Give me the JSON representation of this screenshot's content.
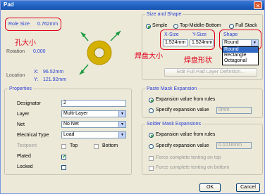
{
  "window": {
    "title": "Pad",
    "close": "✕"
  },
  "preview": {
    "role_size_label": "Role Size",
    "role_size_value": "0.762mm",
    "hole_size_note": "孔大小",
    "rotation_label": "Rotation",
    "rotation_value": "0.000",
    "location_label": "Location",
    "x_label": "X:",
    "x_value": "96.52mm",
    "y_label": "Y:",
    "y_value": "121.92mm",
    "pad_size_note": "焊盘大小",
    "pad_shape_note": "焊盘形状"
  },
  "size_shape": {
    "title": "Size and Shape",
    "modes": [
      "Simple",
      "Top-Middle-Bottom",
      "Full Stack"
    ],
    "selected_mode": "Simple",
    "xsize_header": "X-Size",
    "ysize_header": "Y-Size",
    "shape_header": "Shape",
    "xsize_value": "1.524mm",
    "ysize_value": "1.524mm",
    "shape_value": "Round",
    "shape_options": [
      "Round",
      "Rectangle",
      "Octagonal"
    ],
    "edit_button": "Edit Full Pad Layer Definition..."
  },
  "properties": {
    "title": "Properties",
    "designator_label": "Designator",
    "designator_value": "2",
    "layer_label": "Layer",
    "layer_value": "Multi-Layer",
    "net_label": "Net",
    "net_value": "No Net",
    "etype_label": "Electrical Type",
    "etype_value": "Load",
    "testpoint_label": "Testpoint",
    "top_label": "Top",
    "bottom_label": "Bottom",
    "plated_label": "Plated",
    "locked_label": "Locked",
    "checkmark": "✔"
  },
  "paste": {
    "title": "Paste Mask Expansion",
    "opt1": "Expansion value from rules",
    "opt2": "Specify expansion value",
    "value": "0mm"
  },
  "solder": {
    "title": "Solder Mask Expansions",
    "opt1": "Expansion value from rules",
    "opt2": "Specify expansion value",
    "value": "0.1016mm",
    "tent_top": "Force complete tenting on top",
    "tent_bottom": "Force complete tenting on bottom"
  },
  "buttons": {
    "ok": "OK",
    "cancel": "Cancel"
  },
  "icons": {
    "dropdown": "▼"
  },
  "colors": {
    "annotation": "#e0001b",
    "pad_ring": "#d4b000",
    "arrow": "#1a9a40",
    "label_blue": "#2a3ed6"
  }
}
